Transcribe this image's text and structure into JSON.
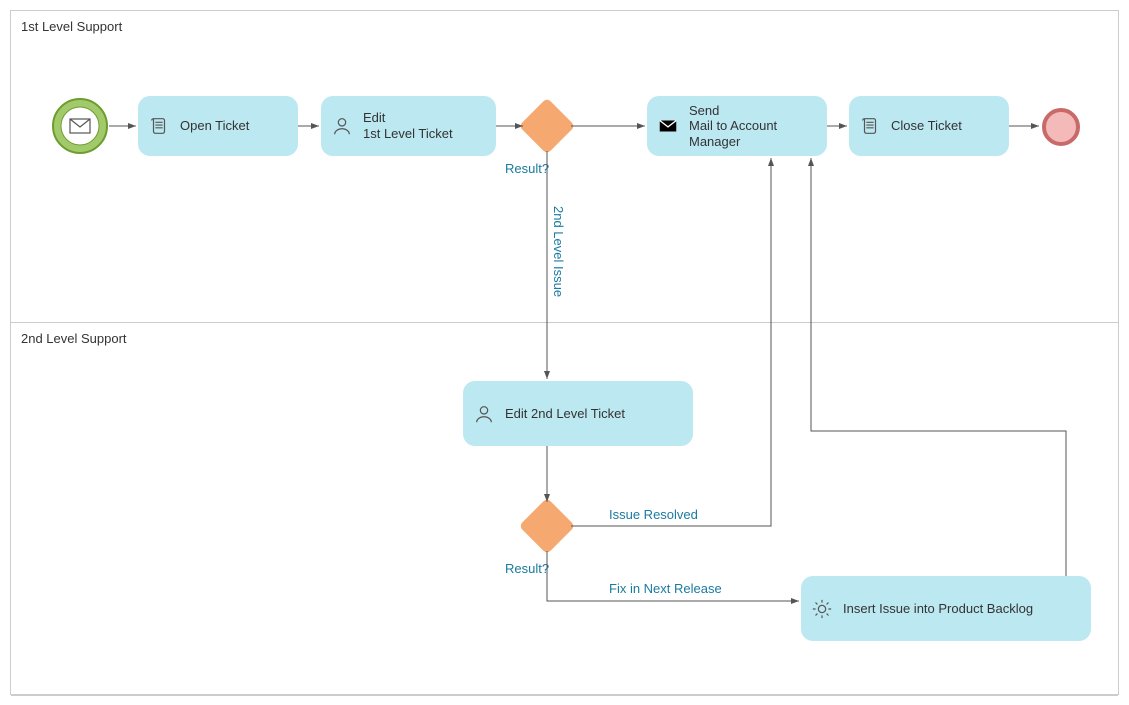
{
  "lanes": {
    "lane1": {
      "label": "1st Level Support"
    },
    "lane2": {
      "label": "2nd Level Support"
    }
  },
  "tasks": {
    "open_ticket": {
      "label": "Open Ticket"
    },
    "edit_l1": {
      "label": "Edit\n1st Level Ticket"
    },
    "send_mail": {
      "label": "Send\nMail to Account\nManager"
    },
    "close_ticket": {
      "label": "Close Ticket"
    },
    "edit_l2": {
      "label": "Edit 2nd Level Ticket"
    },
    "insert_backlog": {
      "label": "Insert Issue into Product Backlog"
    }
  },
  "gateways": {
    "gw1": {
      "label": "Result?"
    },
    "gw2": {
      "label": "Result?"
    }
  },
  "flows": {
    "l2_issue": {
      "label": "2nd Level Issue"
    },
    "issue_resolved": {
      "label": "Issue Resolved"
    },
    "fix_next": {
      "label": "Fix in Next Release"
    }
  },
  "colors": {
    "task_bg": "#bce8f1",
    "gateway_bg": "#f5a86f",
    "label_teal": "#1a7ba0",
    "start_fill": "#a2c96a",
    "end_fill": "#f4b9b9"
  }
}
